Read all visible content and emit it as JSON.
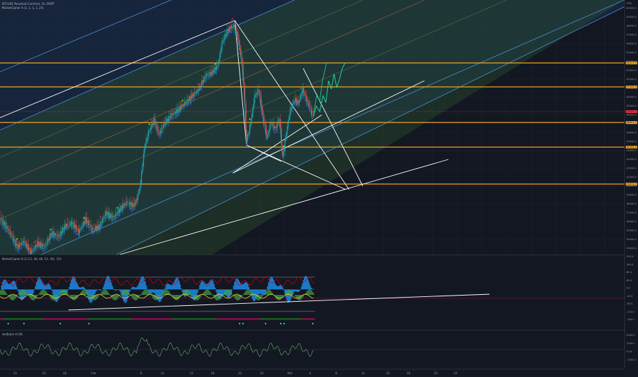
{
  "chart": {
    "title": "BTCUSD Perpetual Contract, 1h, BYBIT",
    "indicator_a": "MarketCipher A (2, 1, 1, 1, 25)",
    "indicator_b": "MarketCipher B (2.2-1, 60, 60, 53, -60, -53)",
    "indicator_c": "wolfpack id (N)",
    "currency": "USD"
  },
  "price_axis": {
    "ticks": [
      "60000.0",
      "59000.0",
      "58000.0",
      "57000.0",
      "56000.0",
      "55000.0",
      "54000.0",
      "53000.0",
      "52000.0",
      "51000.0",
      "50000.0",
      "49000.0",
      "48000.0",
      "47000.0",
      "46000.0",
      "45000.0",
      "44000.0",
      "43000.0",
      "42000.0",
      "41000.0",
      "40000.0",
      "39000.0",
      "38000.0",
      "37000.0",
      "36000.0",
      "35000.0",
      "34000.0",
      "33000.0"
    ],
    "labels": [
      {
        "text": "54011.5",
        "color": "#f5a623"
      },
      {
        "text": "51343.0",
        "color": "#f5a623"
      },
      {
        "text": "49500.0",
        "color": "#f23645"
      },
      {
        "text": "48501.5",
        "color": "#f5a623"
      },
      {
        "text": "45452.0",
        "color": "#f5a623"
      },
      {
        "text": "40814.0",
        "color": "#f5a623"
      }
    ]
  },
  "osc_axis": {
    "ticks": [
      "200.0",
      "160.0",
      "80.0",
      "40.0",
      "0.0",
      "-40.0",
      "-80.0",
      "-120.0",
      "-160.0"
    ]
  },
  "wolf_axis": {
    "ticks": [
      "2000.0",
      "1000.0",
      "0.00",
      "-1000.0"
    ]
  },
  "time_axis": {
    "ticks": [
      "21",
      "25",
      "28",
      "Feb",
      "8",
      "11",
      "15",
      "18",
      "22",
      "25",
      "Mar",
      "4",
      "8",
      "11",
      "15",
      "18",
      "22",
      "25"
    ]
  },
  "stats": {
    "osc_value": "-1.3",
    "wolf_value": "-1.3"
  },
  "colors": {
    "background": "#131722",
    "grid": "#1e222d",
    "channel_outer": "#4a90d9",
    "channel_fill_blue": "#1e3f6b",
    "channel_fill_green": "#2a4a2a",
    "support_line": "#f5a623",
    "trend_line": "#ffffff",
    "projection": "#22d3a0"
  }
}
